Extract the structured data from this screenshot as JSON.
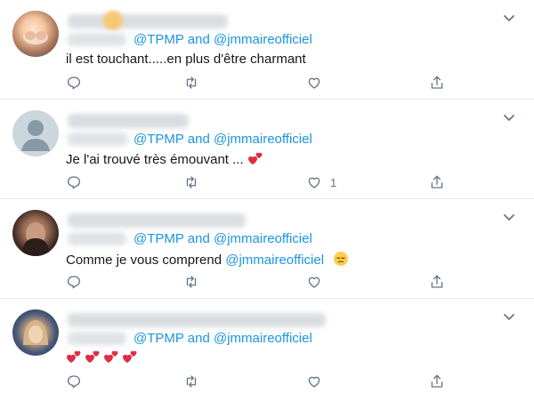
{
  "tweets": [
    {
      "reply_mention_1": "@TPMP",
      "reply_and": "and",
      "reply_mention_2": "@jmmaireofficiel",
      "text": "il est touchant.....en plus d'être charmant",
      "like_count": ""
    },
    {
      "reply_mention_1": "@TPMP",
      "reply_and": "and",
      "reply_mention_2": "@jmmaireofficiel",
      "text": "Je l'ai trouvé très émouvant ...",
      "like_count": "1"
    },
    {
      "reply_mention_1": "@TPMP",
      "reply_and": "and",
      "reply_mention_2": "@jmmaireofficiel",
      "text": "Comme je vous comprend",
      "text_mention": "@jmmaireofficiel",
      "like_count": ""
    },
    {
      "reply_mention_1": "@TPMP",
      "reply_and": "and",
      "reply_mention_2": "@jmmaireofficiel",
      "text": "",
      "like_count": ""
    }
  ],
  "colors": {
    "link": "#1b95e0",
    "icon": "#657786",
    "heart_emoji": "#dd2e44",
    "divider": "#e6ecf0"
  },
  "icons": [
    "chevron-down-icon",
    "reply-icon",
    "retweet-icon",
    "like-icon",
    "share-icon",
    "two-hearts-emoji",
    "pensive-face-emoji"
  ]
}
